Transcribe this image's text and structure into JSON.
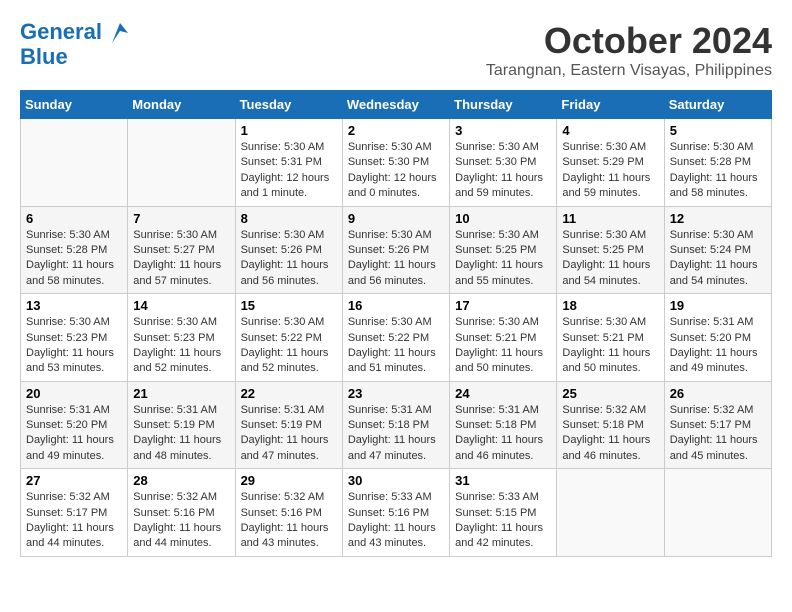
{
  "header": {
    "logo_line1": "General",
    "logo_line2": "Blue",
    "month": "October 2024",
    "location": "Tarangnan, Eastern Visayas, Philippines"
  },
  "columns": [
    "Sunday",
    "Monday",
    "Tuesday",
    "Wednesday",
    "Thursday",
    "Friday",
    "Saturday"
  ],
  "weeks": [
    [
      {
        "num": "",
        "info": ""
      },
      {
        "num": "",
        "info": ""
      },
      {
        "num": "1",
        "info": "Sunrise: 5:30 AM\nSunset: 5:31 PM\nDaylight: 12 hours\nand 1 minute."
      },
      {
        "num": "2",
        "info": "Sunrise: 5:30 AM\nSunset: 5:30 PM\nDaylight: 12 hours\nand 0 minutes."
      },
      {
        "num": "3",
        "info": "Sunrise: 5:30 AM\nSunset: 5:30 PM\nDaylight: 11 hours\nand 59 minutes."
      },
      {
        "num": "4",
        "info": "Sunrise: 5:30 AM\nSunset: 5:29 PM\nDaylight: 11 hours\nand 59 minutes."
      },
      {
        "num": "5",
        "info": "Sunrise: 5:30 AM\nSunset: 5:28 PM\nDaylight: 11 hours\nand 58 minutes."
      }
    ],
    [
      {
        "num": "6",
        "info": "Sunrise: 5:30 AM\nSunset: 5:28 PM\nDaylight: 11 hours\nand 58 minutes."
      },
      {
        "num": "7",
        "info": "Sunrise: 5:30 AM\nSunset: 5:27 PM\nDaylight: 11 hours\nand 57 minutes."
      },
      {
        "num": "8",
        "info": "Sunrise: 5:30 AM\nSunset: 5:26 PM\nDaylight: 11 hours\nand 56 minutes."
      },
      {
        "num": "9",
        "info": "Sunrise: 5:30 AM\nSunset: 5:26 PM\nDaylight: 11 hours\nand 56 minutes."
      },
      {
        "num": "10",
        "info": "Sunrise: 5:30 AM\nSunset: 5:25 PM\nDaylight: 11 hours\nand 55 minutes."
      },
      {
        "num": "11",
        "info": "Sunrise: 5:30 AM\nSunset: 5:25 PM\nDaylight: 11 hours\nand 54 minutes."
      },
      {
        "num": "12",
        "info": "Sunrise: 5:30 AM\nSunset: 5:24 PM\nDaylight: 11 hours\nand 54 minutes."
      }
    ],
    [
      {
        "num": "13",
        "info": "Sunrise: 5:30 AM\nSunset: 5:23 PM\nDaylight: 11 hours\nand 53 minutes."
      },
      {
        "num": "14",
        "info": "Sunrise: 5:30 AM\nSunset: 5:23 PM\nDaylight: 11 hours\nand 52 minutes."
      },
      {
        "num": "15",
        "info": "Sunrise: 5:30 AM\nSunset: 5:22 PM\nDaylight: 11 hours\nand 52 minutes."
      },
      {
        "num": "16",
        "info": "Sunrise: 5:30 AM\nSunset: 5:22 PM\nDaylight: 11 hours\nand 51 minutes."
      },
      {
        "num": "17",
        "info": "Sunrise: 5:30 AM\nSunset: 5:21 PM\nDaylight: 11 hours\nand 50 minutes."
      },
      {
        "num": "18",
        "info": "Sunrise: 5:30 AM\nSunset: 5:21 PM\nDaylight: 11 hours\nand 50 minutes."
      },
      {
        "num": "19",
        "info": "Sunrise: 5:31 AM\nSunset: 5:20 PM\nDaylight: 11 hours\nand 49 minutes."
      }
    ],
    [
      {
        "num": "20",
        "info": "Sunrise: 5:31 AM\nSunset: 5:20 PM\nDaylight: 11 hours\nand 49 minutes."
      },
      {
        "num": "21",
        "info": "Sunrise: 5:31 AM\nSunset: 5:19 PM\nDaylight: 11 hours\nand 48 minutes."
      },
      {
        "num": "22",
        "info": "Sunrise: 5:31 AM\nSunset: 5:19 PM\nDaylight: 11 hours\nand 47 minutes."
      },
      {
        "num": "23",
        "info": "Sunrise: 5:31 AM\nSunset: 5:18 PM\nDaylight: 11 hours\nand 47 minutes."
      },
      {
        "num": "24",
        "info": "Sunrise: 5:31 AM\nSunset: 5:18 PM\nDaylight: 11 hours\nand 46 minutes."
      },
      {
        "num": "25",
        "info": "Sunrise: 5:32 AM\nSunset: 5:18 PM\nDaylight: 11 hours\nand 46 minutes."
      },
      {
        "num": "26",
        "info": "Sunrise: 5:32 AM\nSunset: 5:17 PM\nDaylight: 11 hours\nand 45 minutes."
      }
    ],
    [
      {
        "num": "27",
        "info": "Sunrise: 5:32 AM\nSunset: 5:17 PM\nDaylight: 11 hours\nand 44 minutes."
      },
      {
        "num": "28",
        "info": "Sunrise: 5:32 AM\nSunset: 5:16 PM\nDaylight: 11 hours\nand 44 minutes."
      },
      {
        "num": "29",
        "info": "Sunrise: 5:32 AM\nSunset: 5:16 PM\nDaylight: 11 hours\nand 43 minutes."
      },
      {
        "num": "30",
        "info": "Sunrise: 5:33 AM\nSunset: 5:16 PM\nDaylight: 11 hours\nand 43 minutes."
      },
      {
        "num": "31",
        "info": "Sunrise: 5:33 AM\nSunset: 5:15 PM\nDaylight: 11 hours\nand 42 minutes."
      },
      {
        "num": "",
        "info": ""
      },
      {
        "num": "",
        "info": ""
      }
    ]
  ]
}
